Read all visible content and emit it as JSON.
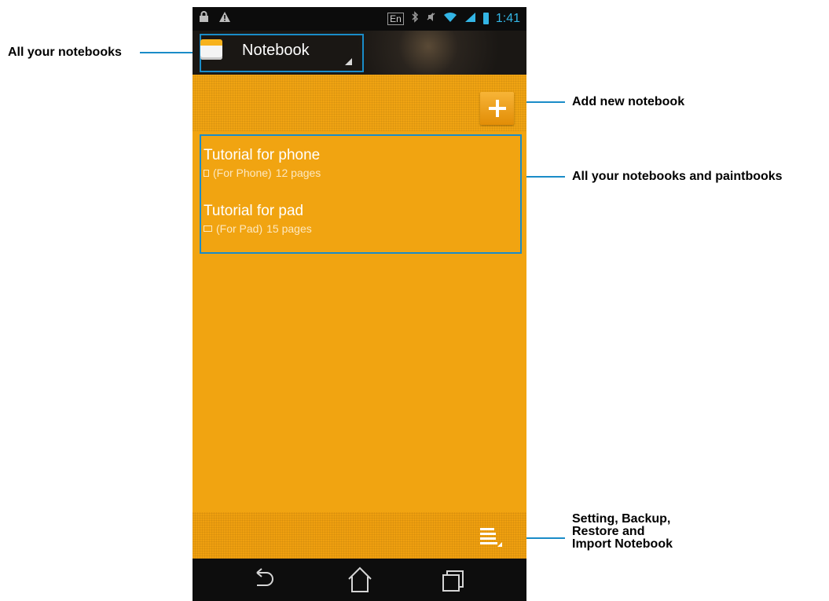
{
  "statusbar": {
    "keyboard_lang": "En",
    "time": "1:41"
  },
  "app": {
    "title": "Notebook"
  },
  "notebooks": [
    {
      "title": "Tutorial for phone",
      "device": "(For Phone)",
      "pages": "12 pages"
    },
    {
      "title": "Tutorial for pad",
      "device": "(For Pad)",
      "pages": "15 pages"
    }
  ],
  "callouts": {
    "all_notebooks": "All your notebooks",
    "add_new": "Add new notebook",
    "list": "All your notebooks and paintbooks",
    "menu": "Setting, Backup,\nRestore and\nImport Notebook"
  },
  "colors": {
    "accent": "#f1a411",
    "callout_line": "#1a8cc8",
    "status_blue": "#33b5e5"
  },
  "icons": {
    "lock": "lock-icon",
    "warning": "warning-icon",
    "bluetooth": "bluetooth-icon",
    "mute": "mute-icon",
    "wifi": "wifi-icon",
    "signal": "signal-icon",
    "battery": "battery-icon",
    "add": "plus-icon",
    "menu": "menu-icon",
    "back": "back-icon",
    "home": "home-icon",
    "recent": "recent-apps-icon"
  }
}
